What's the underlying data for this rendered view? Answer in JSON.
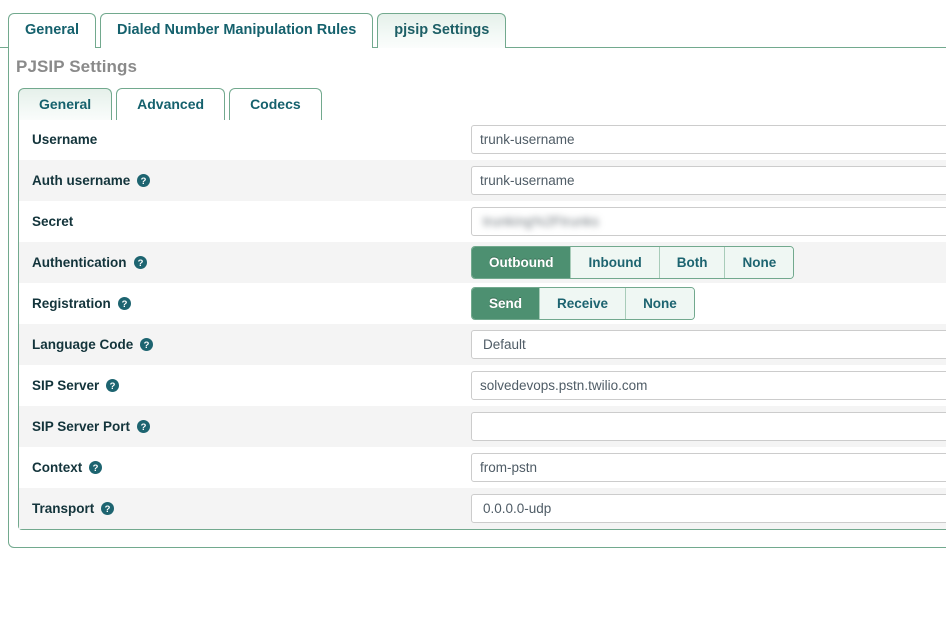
{
  "outer_tabs": [
    {
      "label": "General",
      "active": false
    },
    {
      "label": "Dialed Number Manipulation Rules",
      "active": false
    },
    {
      "label": "pjsip Settings",
      "active": true
    }
  ],
  "page_title": "PJSIP Settings",
  "inner_tabs": [
    {
      "label": "General",
      "active": true
    },
    {
      "label": "Advanced",
      "active": false
    },
    {
      "label": "Codecs",
      "active": false
    }
  ],
  "colors": {
    "accent_green": "#4d9071",
    "border_green": "#72a98e",
    "tab_text": "#15616d",
    "title_gray": "#8a8a8a",
    "row_alt": "#f4f4f4",
    "input_text": "#4f5c66",
    "help_icon": "#1d6470"
  },
  "form": {
    "rows": [
      {
        "label": "Username",
        "has_help": false,
        "type": "text",
        "value": "trunk-username",
        "placeholder": ""
      },
      {
        "label": "Auth username",
        "has_help": true,
        "type": "text",
        "value": "trunk-username",
        "placeholder": ""
      },
      {
        "label": "Secret",
        "has_help": false,
        "type": "secret",
        "value": "trunking%2Ftrunks",
        "placeholder": ""
      },
      {
        "label": "Authentication",
        "has_help": true,
        "type": "buttongroup",
        "options": [
          "Outbound",
          "Inbound",
          "Both",
          "None"
        ],
        "selected": "Outbound"
      },
      {
        "label": "Registration",
        "has_help": true,
        "type": "buttongroup",
        "options": [
          "Send",
          "Receive",
          "None"
        ],
        "selected": "Send"
      },
      {
        "label": "Language Code",
        "has_help": true,
        "type": "select",
        "value": "Default"
      },
      {
        "label": "SIP Server",
        "has_help": true,
        "type": "text",
        "value": "solvedevops.pstn.twilio.com",
        "placeholder": ""
      },
      {
        "label": "SIP Server Port",
        "has_help": true,
        "type": "text",
        "value": "",
        "placeholder": ""
      },
      {
        "label": "Context",
        "has_help": true,
        "type": "text",
        "value": "from-pstn",
        "placeholder": ""
      },
      {
        "label": "Transport",
        "has_help": true,
        "type": "select",
        "value": "0.0.0.0-udp"
      }
    ]
  },
  "icons": {
    "help": "help-circle-icon"
  }
}
